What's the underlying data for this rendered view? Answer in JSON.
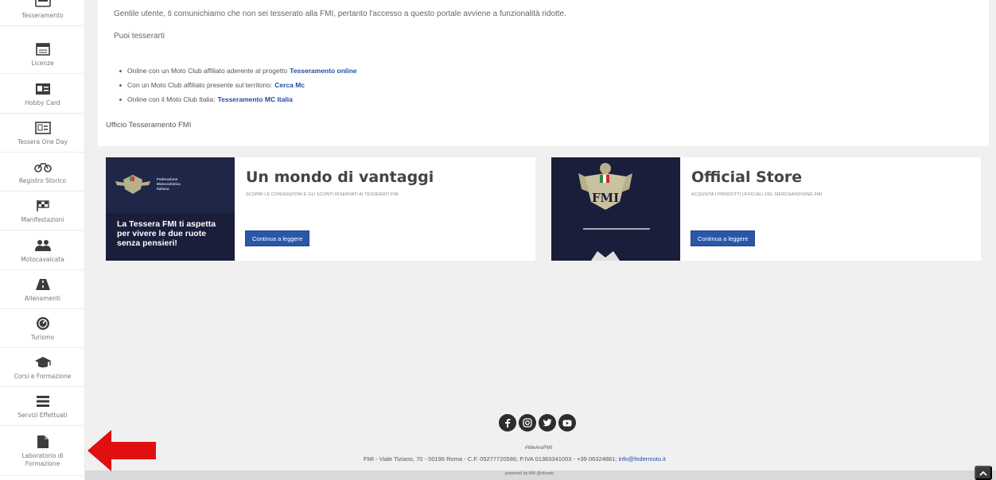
{
  "sidebar": {
    "items": [
      {
        "label": "Tesseramento",
        "icon": "membership-card-icon"
      },
      {
        "label": "Licenze",
        "icon": "license-icon"
      },
      {
        "label": "Hobby Card",
        "icon": "id-card-icon"
      },
      {
        "label": "Tessera One Day",
        "icon": "id-card-outline-icon"
      },
      {
        "label": "Registro Storico",
        "icon": "motorcycle-icon"
      },
      {
        "label": "Manifestazioni",
        "icon": "flag-icon"
      },
      {
        "label": "Motocavalcata",
        "icon": "users-icon"
      },
      {
        "label": "Allenamenti",
        "icon": "road-icon"
      },
      {
        "label": "Turismo",
        "icon": "speedometer-icon"
      },
      {
        "label": "Corsi e Formazione",
        "icon": "graduation-cap-icon"
      },
      {
        "label": "Servizi Effettuati",
        "icon": "list-icon"
      },
      {
        "label": "Laboratorio di Formazione",
        "icon": "document-icon"
      }
    ]
  },
  "notice": {
    "message": "Gentile utente, ti comunichiamo che non sei tesserato alla FMI, pertanto l'accesso a questo portale avviene a funzionalità ridotte.",
    "prompt": "Puoi tesserarti",
    "options": [
      {
        "text": "Online con un Moto Club affiliato aderente al progetto",
        "link": "Tesseramento online"
      },
      {
        "text": "Con un Moto Club affiliato presente sul territorio:",
        "link": "Cerca Mc"
      },
      {
        "text": "Online con il Moto Club Italia:",
        "link": "Tesseramento MC Italia"
      }
    ],
    "signature": "Ufficio Tesseramento FMI"
  },
  "cards": [
    {
      "title": "Un mondo di vantaggi",
      "subtitle": "SCOPRI LE CONVENZIONI E GLI SCONTI RISERVATI AI TESSERATI FMI",
      "button": "Continua a leggere",
      "image_org": "Federazione Motociclistica Italiana",
      "image_text": "La Tessera FMI ti aspetta per vivere le due ruote senza pensieri!"
    },
    {
      "title": "Official Store",
      "subtitle": "ACQUISTA I PRODOTTI UFFICIALI DEL MERCHANDISING FMI",
      "button": "Continua a leggere",
      "logo_text": "FMI"
    }
  ],
  "footer": {
    "social": [
      "facebook-icon",
      "instagram-icon",
      "twitter-icon",
      "youtube-icon"
    ],
    "hashtag": "#WeAreFMI",
    "address": "FMI - Viale Tiziano, 70 - 00196 Roma - C.F. 05277720586; P.IVA 01383341003 - +39 06324881;",
    "email": "info@federmoto.it",
    "powered": "powered by AM @nkweb"
  },
  "colors": {
    "accent": "#2b57a8",
    "link": "#1f4ea8",
    "background": "#f0f0f0",
    "card_dark": "#1a1e3a",
    "arrow": "#e01010"
  }
}
